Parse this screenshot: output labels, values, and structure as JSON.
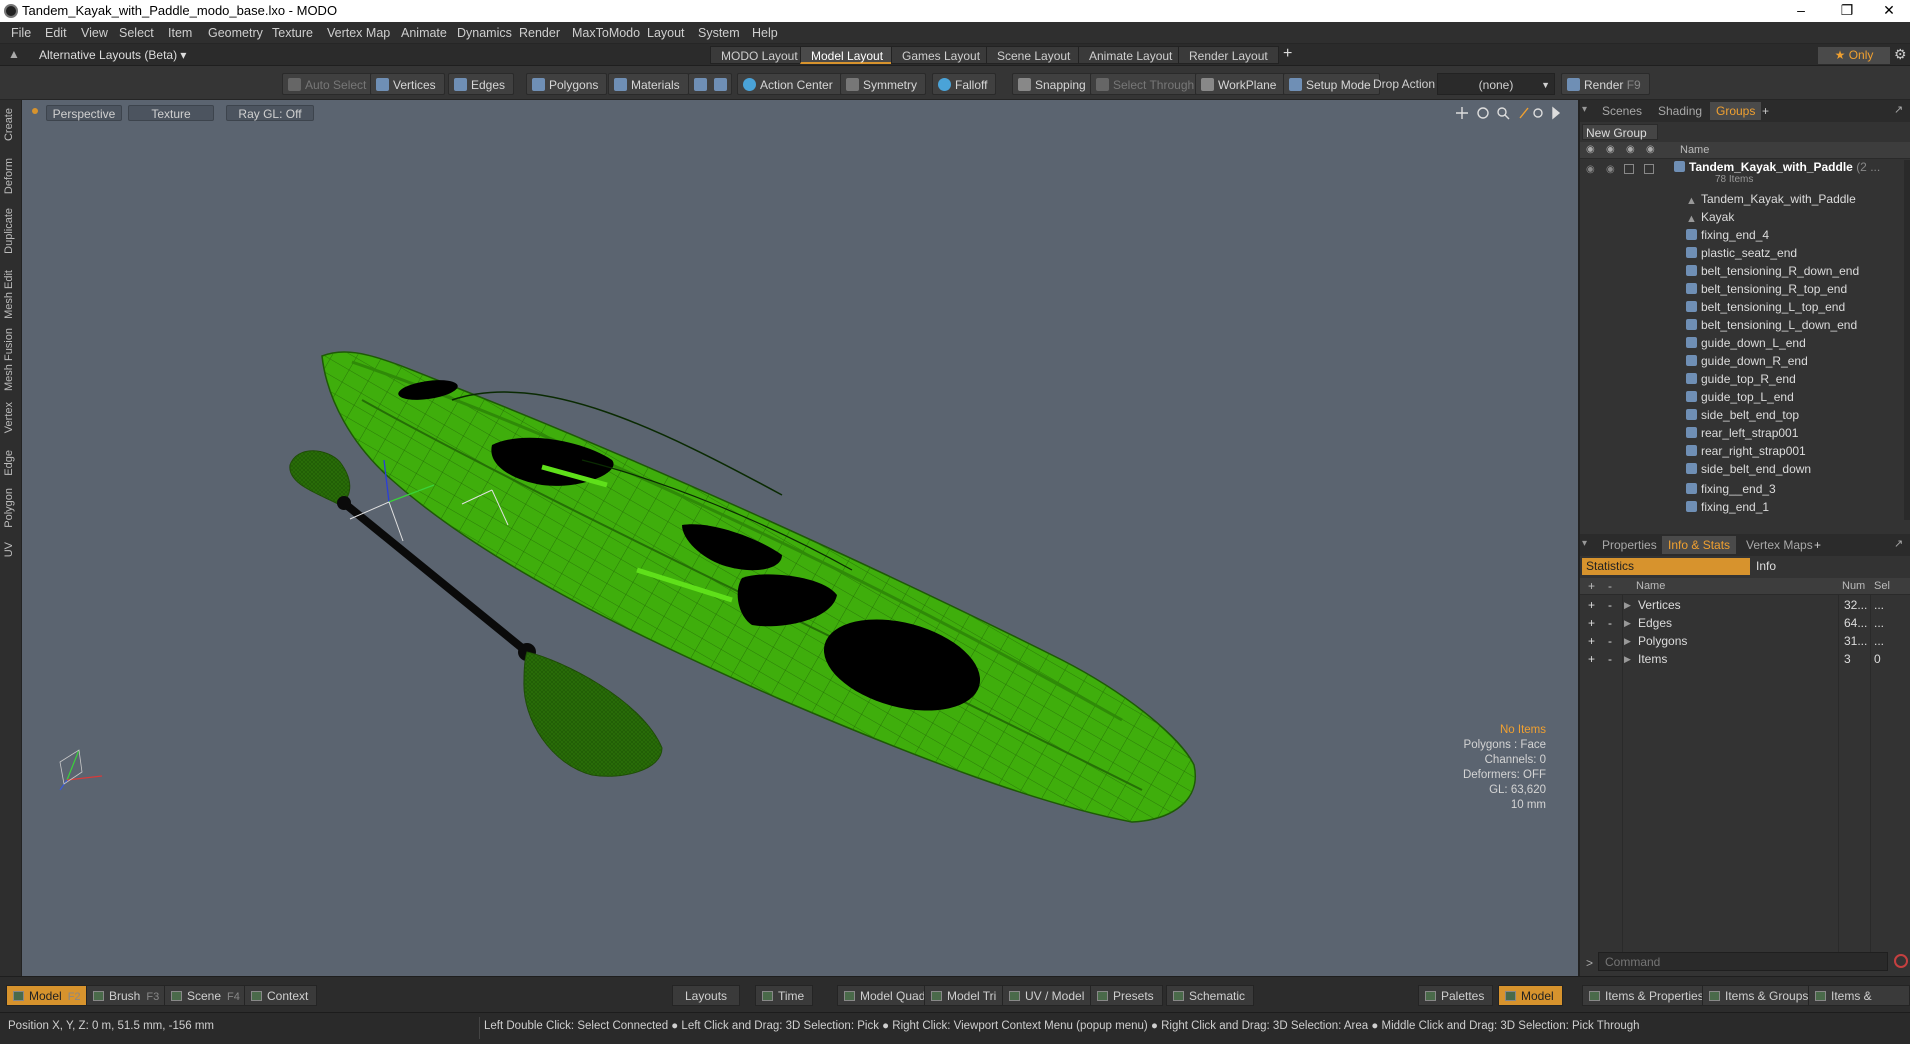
{
  "window": {
    "title": "Tandem_Kayak_with_Paddle_modo_base.lxo - MODO",
    "minimize": "–",
    "restore": "❐",
    "close": "✕"
  },
  "menu": [
    "File",
    "Edit",
    "View",
    "Select",
    "Item",
    "Geometry",
    "Texture",
    "Vertex Map",
    "Animate",
    "Dynamics",
    "Render",
    "MaxToModo",
    "Layout",
    "System",
    "Help"
  ],
  "layouts": {
    "switcher": "Alternative Layouts (Beta) ▾",
    "tabs": [
      "MODO Layout",
      "Model Layout",
      "Games Layout",
      "Scene Layout",
      "Animate Layout",
      "Render Layout"
    ],
    "active_tab": "Model Layout",
    "add": "+",
    "only": "★ Only",
    "gear": "⚙"
  },
  "toolbar": {
    "auto_select": "Auto Select",
    "vertices": "Vertices",
    "edges": "Edges",
    "polygons": "Polygons",
    "materials": "Materials",
    "action_center": "Action Center",
    "symmetry": "Symmetry",
    "falloff": "Falloff",
    "snapping": "Snapping",
    "select_through": "Select Through",
    "workplane": "WorkPlane",
    "setup_mode": "Setup Mode",
    "drop_action_label": "Drop Action",
    "drop_action_value": "(none)",
    "render": "Render",
    "render_key": "F9"
  },
  "left_tabs": [
    "Create",
    "Deform",
    "Duplicate",
    "Mesh Edit",
    "Mesh Fusion",
    "Vertex",
    "Edge",
    "Polygon",
    "UV"
  ],
  "viewport": {
    "view": "Perspective",
    "shading": "Texture",
    "raygl": "Ray GL: Off",
    "stats": {
      "items": "No Items",
      "polygons": "Polygons : Face",
      "channels": "Channels: 0",
      "deformers": "Deformers: OFF",
      "gl": "GL: 63,620",
      "grid": "10 mm"
    },
    "colors": {
      "background": "#5b6470",
      "kayak": "#3fae0c",
      "wire": "#1e5a06"
    }
  },
  "groups_panel": {
    "tabs": [
      "Scenes",
      "Shading",
      "Groups"
    ],
    "active_tab": "Groups",
    "add": "+",
    "new_group": "New Group",
    "name_header": "Name",
    "root": {
      "name": "Tandem_Kayak_with_Paddle",
      "suffix": "(2 ...",
      "count": "78 Items"
    },
    "items": [
      {
        "name": "Tandem_Kayak_with_Paddle",
        "icon": "locator-icon"
      },
      {
        "name": "Kayak",
        "icon": "locator-icon"
      },
      {
        "name": "fixing_end_4",
        "icon": "mesh-icon"
      },
      {
        "name": "plastic_seatz_end",
        "icon": "mesh-icon"
      },
      {
        "name": "belt_tensioning_R_down_end",
        "icon": "mesh-icon"
      },
      {
        "name": "belt_tensioning_R_top_end",
        "icon": "mesh-icon"
      },
      {
        "name": "belt_tensioning_L_top_end",
        "icon": "mesh-icon"
      },
      {
        "name": "belt_tensioning_L_down_end",
        "icon": "mesh-icon"
      },
      {
        "name": "guide_down_L_end",
        "icon": "mesh-icon"
      },
      {
        "name": "guide_down_R_end",
        "icon": "mesh-icon"
      },
      {
        "name": "guide_top_R_end",
        "icon": "mesh-icon"
      },
      {
        "name": "guide_top_L_end",
        "icon": "mesh-icon"
      },
      {
        "name": "side_belt_end_top",
        "icon": "mesh-icon"
      },
      {
        "name": "rear_left_strap001",
        "icon": "mesh-icon"
      },
      {
        "name": "rear_right_strap001",
        "icon": "mesh-icon"
      },
      {
        "name": "side_belt_end_down",
        "icon": "mesh-icon"
      },
      {
        "name": "fixing__end_3",
        "icon": "mesh-icon"
      },
      {
        "name": "fixing_end_1",
        "icon": "mesh-icon"
      }
    ]
  },
  "info_panel": {
    "tabs": [
      "Properties",
      "Info & Stats",
      "Vertex Maps"
    ],
    "active_tab": "Info & Stats",
    "add": "+",
    "subtabs": [
      "Statistics",
      "Info"
    ],
    "headers": {
      "name": "Name",
      "num": "Num",
      "sel": "Sel"
    },
    "rows": [
      {
        "name": "Vertices",
        "num": "32...",
        "sel": "..."
      },
      {
        "name": "Edges",
        "num": "64...",
        "sel": "..."
      },
      {
        "name": "Polygons",
        "num": "31...",
        "sel": "..."
      },
      {
        "name": "Items",
        "num": "3",
        "sel": "0"
      }
    ],
    "command_placeholder": "Command"
  },
  "bottom": {
    "model": "Model",
    "model_key": "F2",
    "brush": "Brush",
    "brush_key": "F3",
    "scene": "Scene",
    "scene_key": "F4",
    "context": "Context",
    "layouts": "Layouts",
    "time": "Time",
    "model_quad": "Model Quad",
    "model_tri": "Model Tri",
    "uv_model": "UV / Model",
    "presets": "Presets",
    "schematic": "Schematic",
    "palettes": "Palettes",
    "model_right": "Model",
    "items_properties": "Items & Properties",
    "items_groups": "Items & Groups",
    "items_shading": "Items & Shading"
  },
  "status": {
    "position": "Position X, Y, Z:   0 m, 51.5 mm, -156 mm",
    "hints": "Left Double Click: Select Connected ● Left Click and Drag: 3D Selection: Pick ● Right Click: Viewport Context Menu (popup menu) ● Right Click and Drag: 3D Selection: Area ● Middle Click and Drag: 3D Selection: Pick Through"
  }
}
